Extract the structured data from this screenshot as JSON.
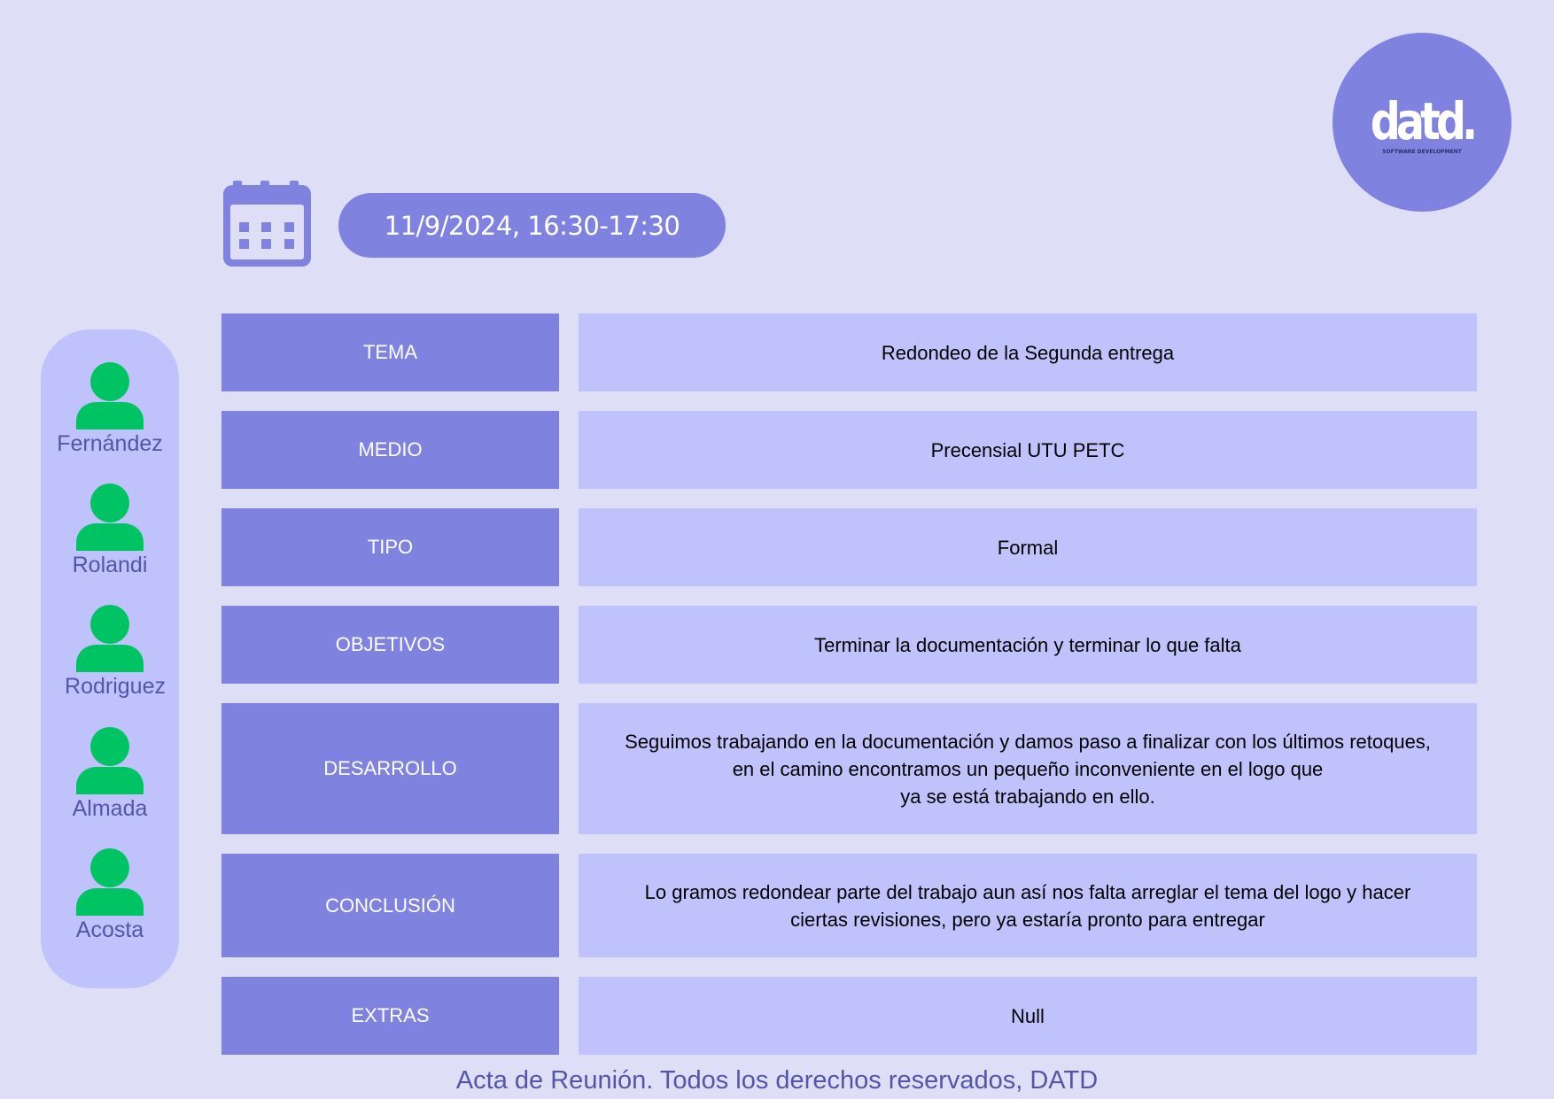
{
  "logo": {
    "wordmark": "datd.",
    "tagline": "SOFTWARE DEVELOPMENT"
  },
  "meeting": {
    "datetime": "11/9/2024, 16:30-17:30",
    "calendar_icon": "calendar-icon"
  },
  "attendees": [
    {
      "name": "Fernández",
      "icon": "person-icon"
    },
    {
      "name": "Rolandi",
      "icon": "person-icon"
    },
    {
      "name": "Rodriguez",
      "icon": "person-icon"
    },
    {
      "name": "Almada",
      "icon": "person-icon"
    },
    {
      "name": "Acosta",
      "icon": "person-icon"
    }
  ],
  "rows": [
    {
      "label": "TEMA",
      "value": "Redondeo de la Segunda entrega"
    },
    {
      "label": "MEDIO",
      "value": "Precensial UTU PETC"
    },
    {
      "label": "TIPO",
      "value": "Formal"
    },
    {
      "label": "OBJETIVOS",
      "value": "Terminar la documentación y terminar lo que falta"
    },
    {
      "label": "DESARROLLO",
      "value": "Seguimos trabajando en la documentación y damos paso a finalizar con los últimos retoques,\nen el camino encontramos un pequeño inconveniente en el logo que\nya se está trabajando en ello."
    },
    {
      "label": "CONCLUSIÓN",
      "value": "Lo gramos redondear parte del trabajo aun así nos falta arreglar el tema del logo y hacer\nciertas revisiones, pero ya estaría pronto para entregar"
    },
    {
      "label": "EXTRAS",
      "value": "Null"
    }
  ],
  "footer": {
    "text": "Acta de Reunión. Todos los derechos reservados, DATD"
  },
  "colors": {
    "background": "#dedff7",
    "accent": "#7f83df",
    "panel": "#bfc2fb",
    "person": "#00c364",
    "name_text": "#5356a8"
  }
}
